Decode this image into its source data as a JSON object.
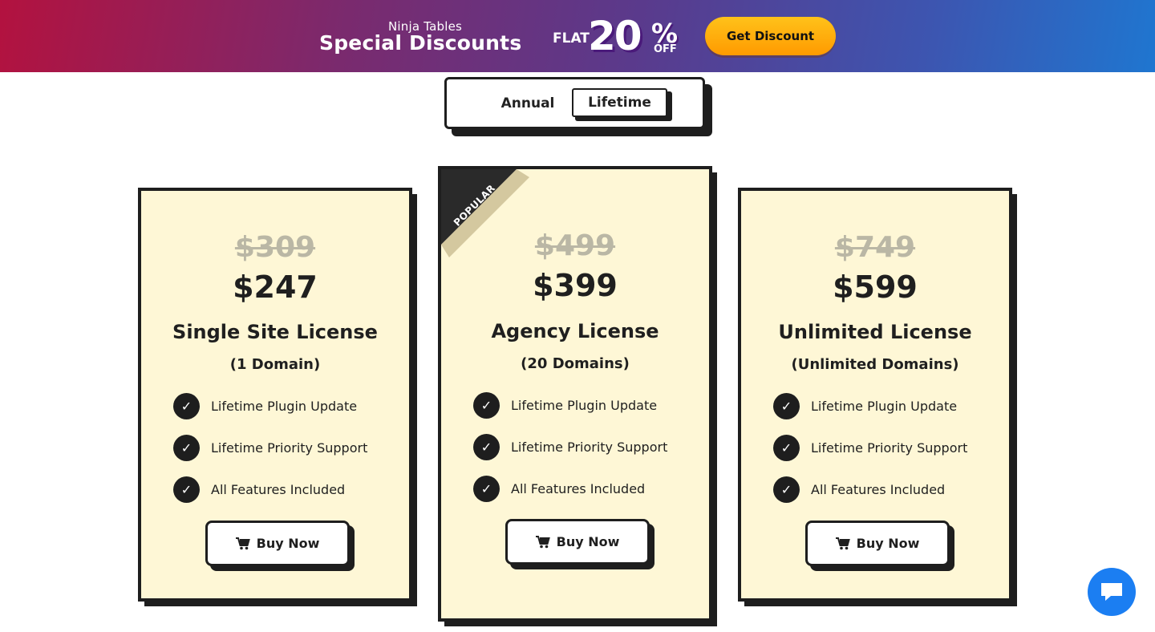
{
  "banner": {
    "brand_top": "Ninja Tables",
    "brand_main": "Special Discounts",
    "flat_label": "FLAT",
    "discount_value": "20",
    "percent_sign": "%",
    "off_label": "OFF",
    "cta_label": "Get Discount"
  },
  "toggle": {
    "options": [
      "Annual",
      "Lifetime"
    ],
    "selected": "Lifetime"
  },
  "plans": [
    {
      "old_price": "$309",
      "price": "$247",
      "name": "Single Site License",
      "domains": "(1 Domain)",
      "features": [
        "Lifetime Plugin Update",
        "Lifetime Priority Support",
        "All Features Included"
      ],
      "button_label": "Buy Now",
      "badge": ""
    },
    {
      "old_price": "$499",
      "price": "$399",
      "name": "Agency License",
      "domains": "(20 Domains)",
      "features": [
        "Lifetime Plugin Update",
        "Lifetime Priority Support",
        "All Features Included"
      ],
      "button_label": "Buy Now",
      "badge": "POPULAR"
    },
    {
      "old_price": "$749",
      "price": "$599",
      "name": "Unlimited License",
      "domains": "(Unlimited Domains)",
      "features": [
        "Lifetime Plugin Update",
        "Lifetime Priority Support",
        "All Features Included"
      ],
      "button_label": "Buy Now",
      "badge": ""
    }
  ],
  "icons": {
    "feature": "check-icon",
    "button": "cart-icon",
    "chat": "chat-bubble-icon"
  },
  "colors": {
    "card_bg": "#fef7d6",
    "border": "#1e1e1e",
    "cta_orange": "#ff9a00",
    "chat_blue": "#1b7ef2"
  }
}
